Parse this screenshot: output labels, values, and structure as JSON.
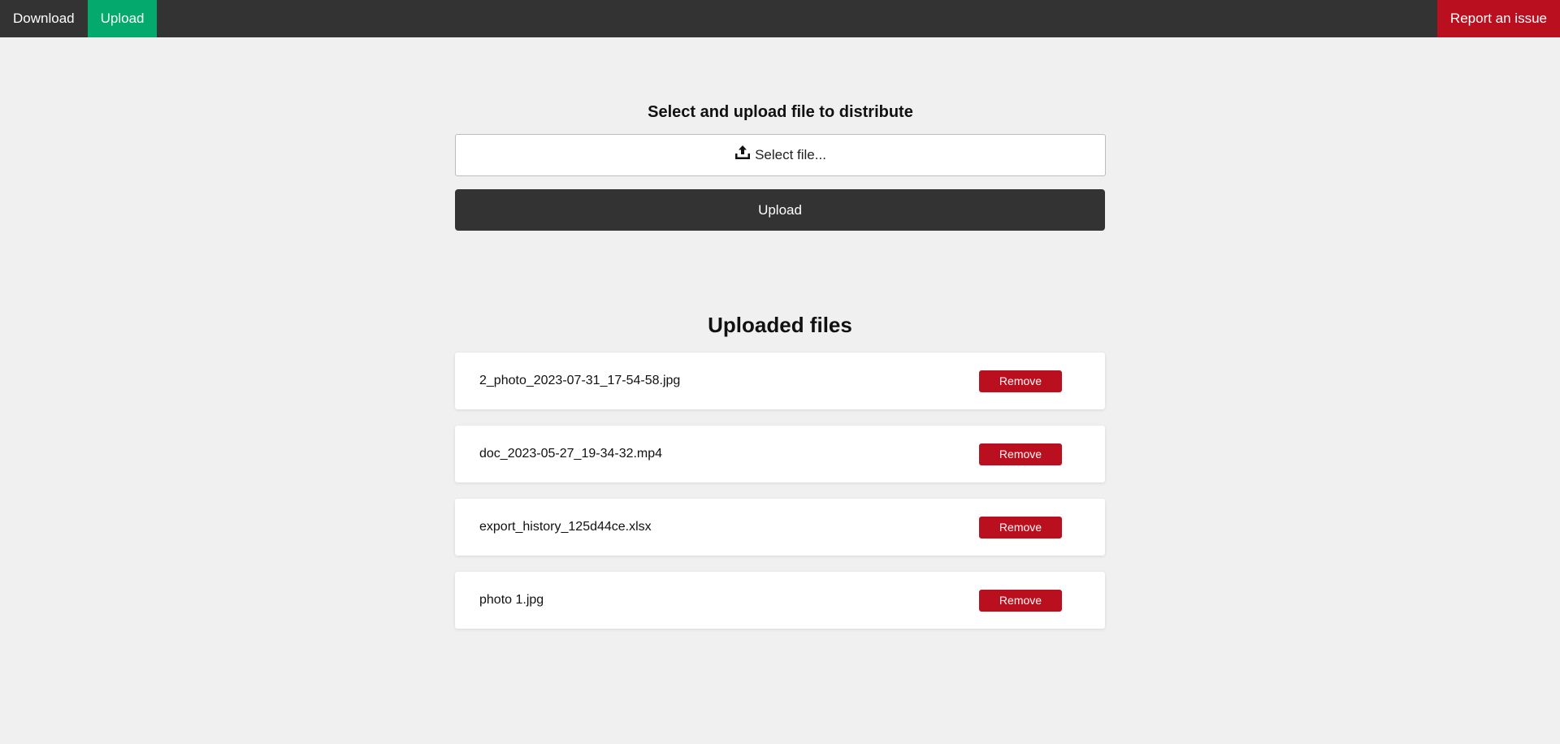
{
  "nav": {
    "download_label": "Download",
    "upload_label": "Upload",
    "report_label": "Report an issue",
    "active_tab": "Upload"
  },
  "upload": {
    "title": "Select and upload file to distribute",
    "select_label": "Select file...",
    "select_icon": "upload-tray-icon",
    "button_label": "Upload"
  },
  "files": {
    "title": "Uploaded files",
    "items": [
      {
        "name": "2_photo_2023-07-31_17-54-58.jpg",
        "action": "Remove"
      },
      {
        "name": "doc_2023-05-27_19-34-32.mp4",
        "action": "Remove"
      },
      {
        "name": "export_history_125d44ce.xlsx",
        "action": "Remove"
      },
      {
        "name": "photo 1.jpg",
        "action": "Remove"
      }
    ]
  },
  "colors": {
    "topbar": "#333333",
    "active_tab": "#04aa6d",
    "danger": "#b90f1f",
    "page_bg": "#f0f0f0"
  }
}
